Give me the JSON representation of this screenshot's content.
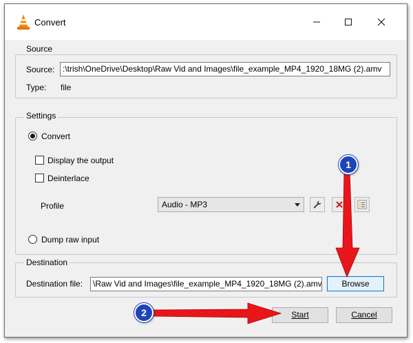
{
  "window": {
    "title": "Convert"
  },
  "source": {
    "group_title": "Source",
    "source_label": "Source:",
    "source_value": ":\\trish\\OneDrive\\Desktop\\Raw Vid and Images\\file_example_MP4_1920_18MG (2).amv",
    "type_label": "Type:",
    "type_value": "file"
  },
  "settings": {
    "group_title": "Settings",
    "convert_label": "Convert",
    "display_output_label": "Display the output",
    "deinterlace_label": "Deinterlace",
    "profile_label": "Profile",
    "profile_value": "Audio - MP3",
    "dump_raw_label": "Dump raw input"
  },
  "destination": {
    "group_title": "Destination",
    "file_label": "Destination file:",
    "file_value": "\\Raw Vid and Images\\file_example_MP4_1920_18MG (2).amv",
    "browse_label": "Browse"
  },
  "buttons": {
    "start_label": "Start",
    "cancel_label": "Cancel"
  },
  "annotations": {
    "badge1": "1",
    "badge2": "2"
  },
  "colors": {
    "arrow": "#e8161b",
    "badge": "#1f44b8",
    "focus_border": "#0078d7"
  }
}
